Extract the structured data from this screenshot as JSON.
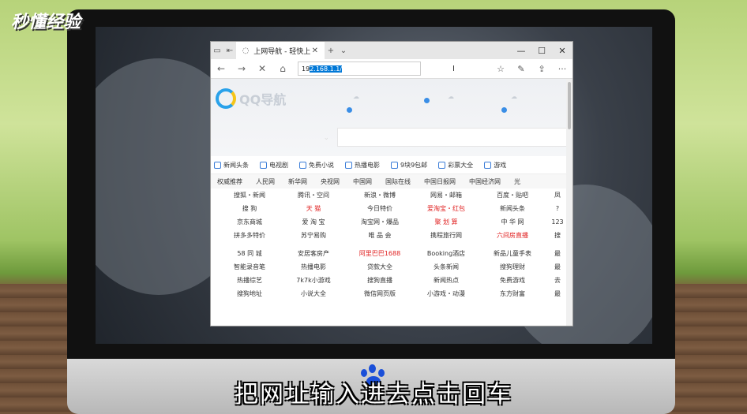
{
  "watermark": {
    "logo_text": "秒懂经验"
  },
  "subtitle": "把网址输入进去点击回车",
  "browser": {
    "tab_title": "上网导航 - 轻快上网 从",
    "new_tab_icon": "+",
    "tab_menu_icon": "⌄",
    "window": {
      "minimize": "—",
      "maximize": "☐",
      "close": "✕"
    },
    "nav": {
      "back": "←",
      "forward": "→",
      "stop": "✕",
      "home": "⌂"
    },
    "address_prefix": "19",
    "address_selected": "2.168.1.1/",
    "right_icons": {
      "favorites": "☆",
      "notes": "✎",
      "share": "⇪",
      "more": "···"
    },
    "page": {
      "brand": "QQ导航",
      "search_select_icon": "⌄",
      "categories": [
        "新闻头条",
        "电视剧",
        "免费小说",
        "热播电影",
        "9块9包邮",
        "彩票大全",
        "游戏"
      ],
      "nav_links": [
        "权威推荐",
        "人民网",
        "新华网",
        "央视网",
        "中国网",
        "国际在线",
        "中国日报网",
        "中国经济网",
        "光"
      ],
      "rows_top": [
        [
          "搜狐・新闻",
          "腾讯・空间",
          "新浪・微博",
          "网易・邮箱",
          "百度・贴吧",
          "凤"
        ],
        [
          "搜 狗",
          "天 猫",
          "今日特价",
          "爱淘宝・红包",
          "新闻头条",
          "?"
        ],
        [
          "京东商城",
          "爱 淘 宝",
          "淘宝网・爆品",
          "聚 划 算",
          "中 华 网",
          "123"
        ],
        [
          "拼多多特价",
          "苏宁易购",
          "唯 品 会",
          "携程旅行网",
          "六间房直播",
          "搜"
        ]
      ],
      "rows_bottom": [
        [
          "58 同 城",
          "安居客房产",
          "阿里巴巴1688",
          "Booking酒店",
          "新品儿童手表",
          "最"
        ],
        [
          "智能录音笔",
          "热播电影",
          "贷款大全",
          "头条新闻",
          "搜狗理财",
          "最"
        ],
        [
          "热播综艺",
          "7k7k小游戏",
          "搜狗直播",
          "新闻热点",
          "免费游戏",
          "去"
        ],
        [
          "搜狗地址",
          "小说大全",
          "微信网页版",
          "小游戏・动漫",
          "东方财富",
          "最"
        ]
      ]
    }
  }
}
